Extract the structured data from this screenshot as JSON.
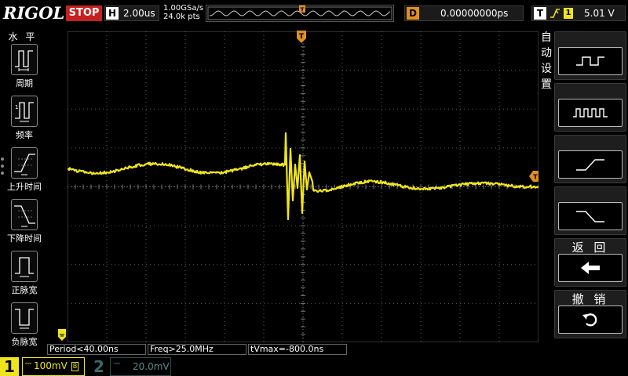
{
  "brand": {
    "logo": "RIGOL"
  },
  "run_state": {
    "label": "STOP"
  },
  "horizontal": {
    "tag": "H",
    "timebase": "2.00us",
    "sample_rate": "1.00GSa/s",
    "memory_depth": "24.0k pts"
  },
  "delay": {
    "tag": "D",
    "value": "0.00000000ps"
  },
  "trigger": {
    "tag": "T",
    "source": "1",
    "level": "5.01 V",
    "marker": "T"
  },
  "left_menu": {
    "title": "水 平",
    "items": [
      {
        "label": "周期",
        "icon": "period-icon"
      },
      {
        "label": "频率",
        "icon": "frequency-icon"
      },
      {
        "label": "上升时间",
        "icon": "rise-time-icon"
      },
      {
        "label": "下降时间",
        "icon": "fall-time-icon"
      },
      {
        "label": "正脉宽",
        "icon": "positive-width-icon"
      },
      {
        "label": "负脉宽",
        "icon": "negative-width-icon"
      }
    ]
  },
  "right_menu": {
    "title": [
      "自",
      "动",
      "设",
      "置"
    ],
    "buttons": [
      {
        "icon": "single-cycle-icon"
      },
      {
        "icon": "multi-cycle-icon"
      },
      {
        "icon": "rising-edge-icon"
      },
      {
        "icon": "falling-edge-icon"
      },
      {
        "label": "返 回",
        "icon": "back-arrow-icon"
      },
      {
        "label": "撤 销",
        "icon": "undo-icon"
      }
    ]
  },
  "measurements": [
    {
      "text": "Period<40.00ns"
    },
    {
      "text": "Freq>25.0MHz"
    },
    {
      "text": "tVmax=-800.0ns"
    }
  ],
  "channels": {
    "ch1": {
      "number": "1",
      "coupling": "⎓",
      "scale": "100mV",
      "bw_mark": "B"
    },
    "ch2": {
      "number": "2",
      "coupling": "⎓",
      "scale": "20.0mV"
    }
  },
  "colors": {
    "ch1": "#f0e51c",
    "stop": "#c62020",
    "delay_tag": "#e08f21",
    "grid": "#5a5a5a"
  }
}
